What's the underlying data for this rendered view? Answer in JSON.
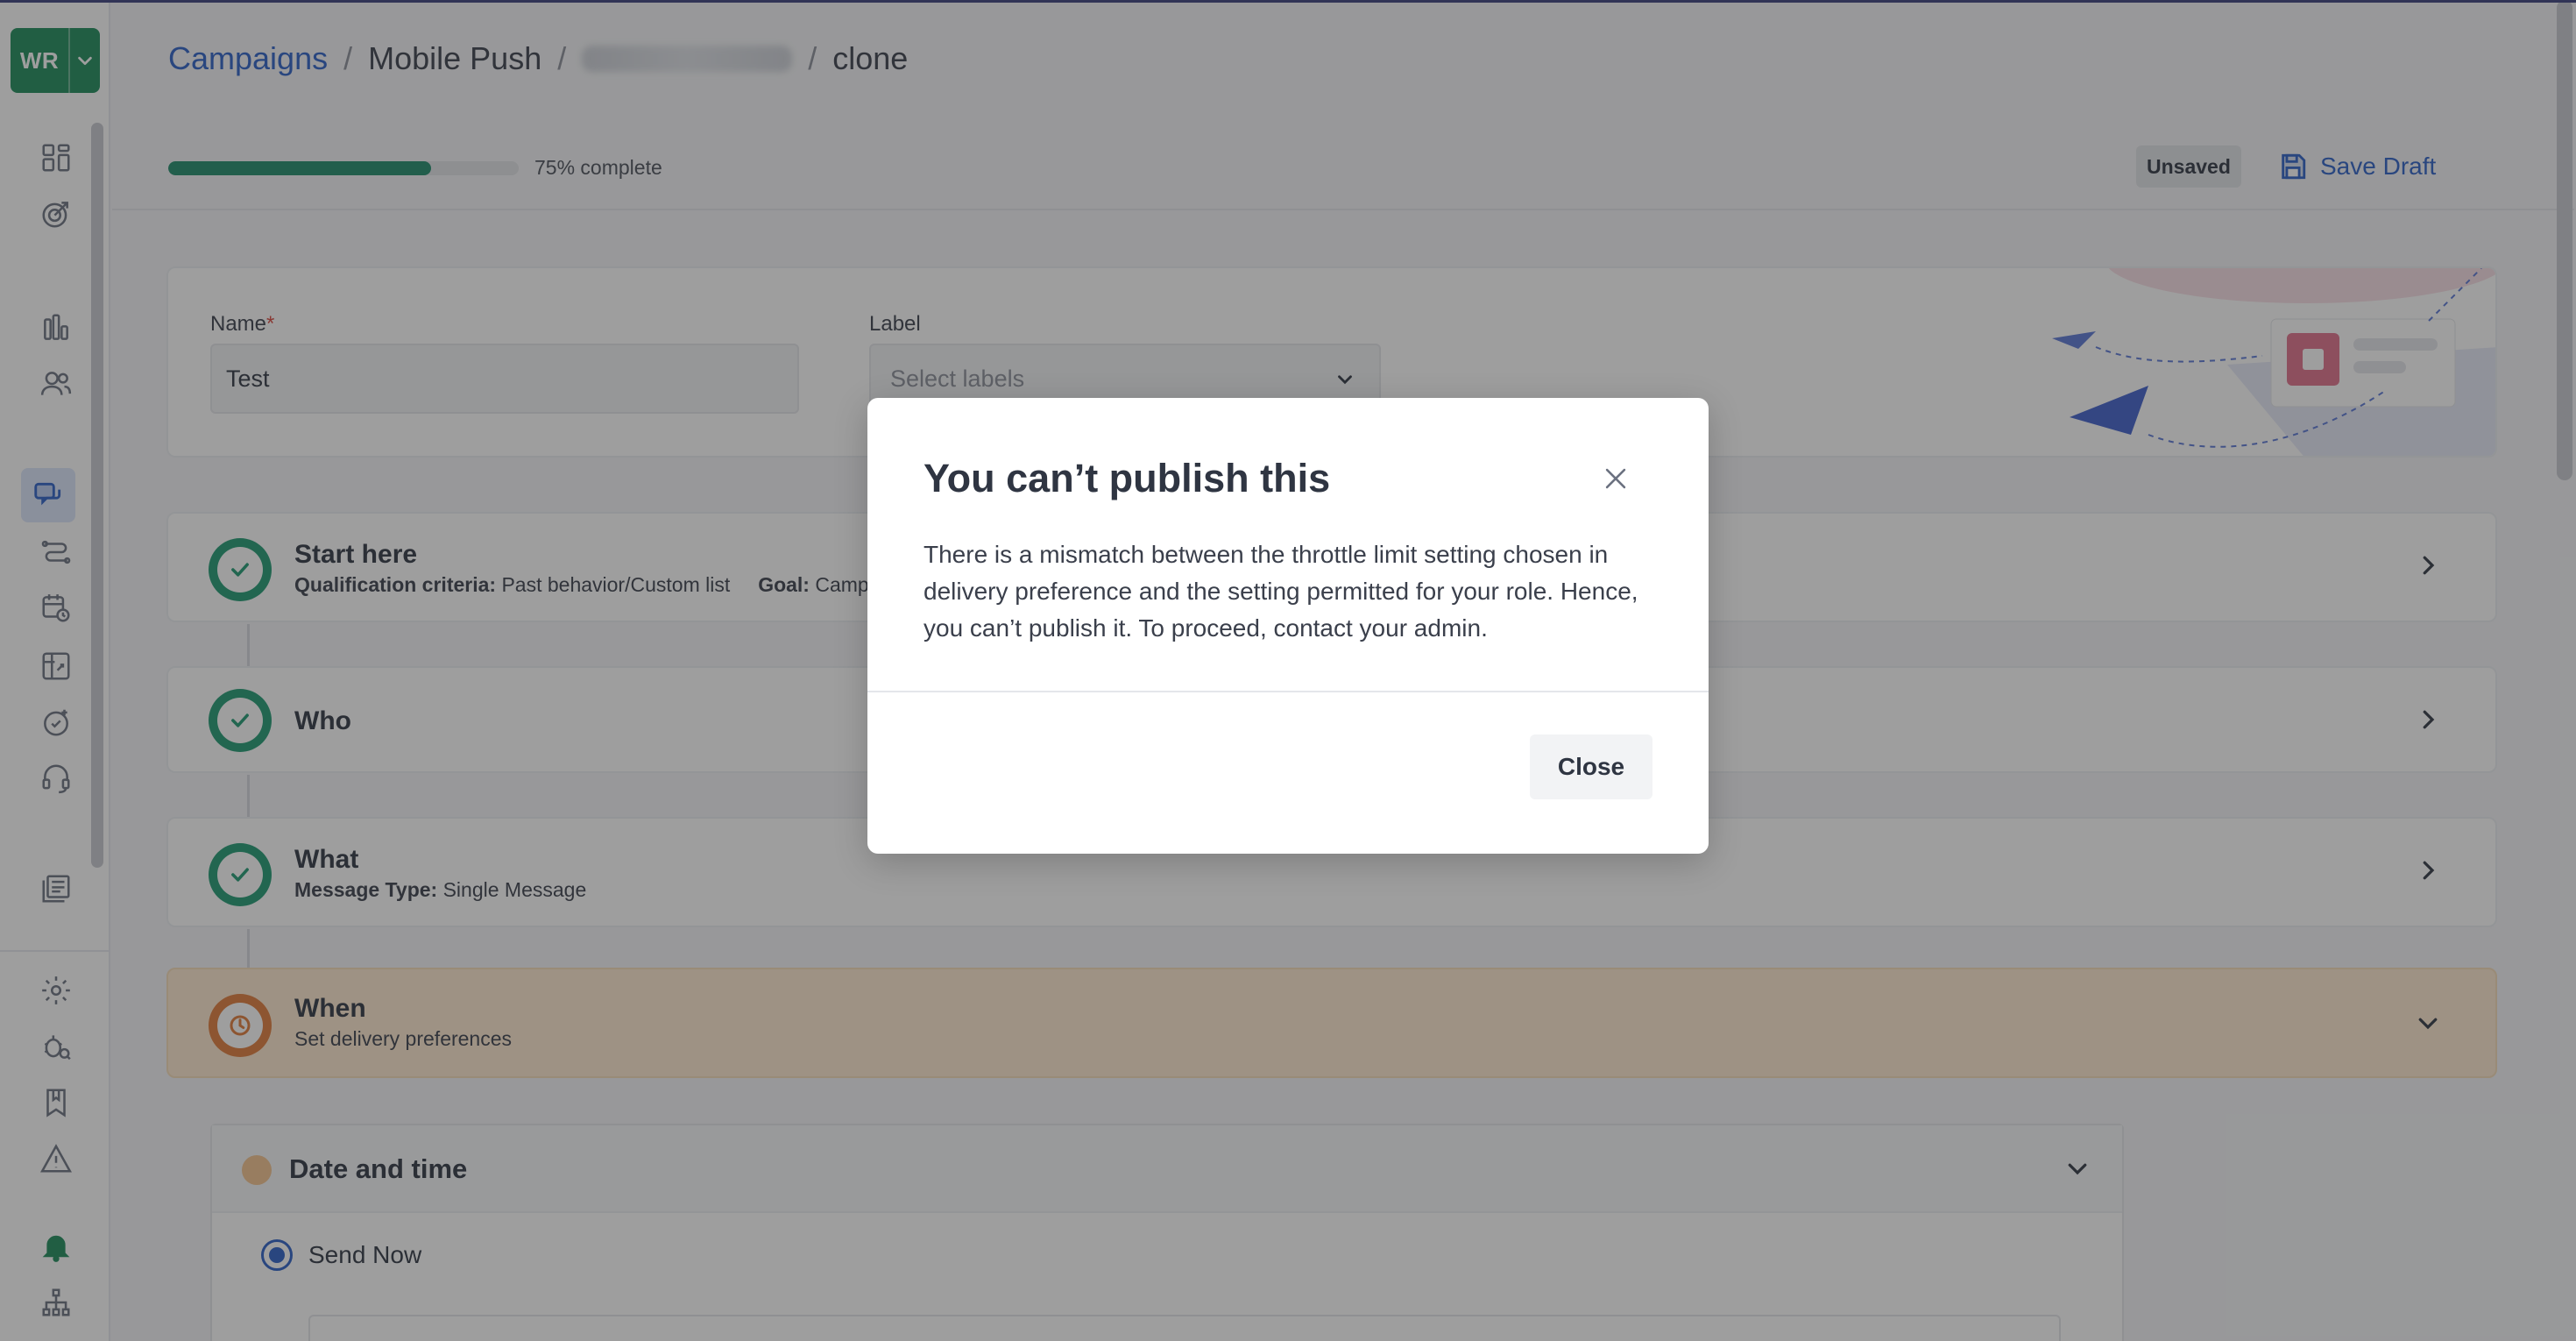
{
  "workspace": {
    "initials": "WR"
  },
  "breadcrumb": {
    "items": [
      "Campaigns",
      "Mobile Push",
      "clone"
    ],
    "separator": "/"
  },
  "progress": {
    "percent": 75,
    "label": "75% complete"
  },
  "header": {
    "status_badge": "Unsaved",
    "save_label": "Save Draft"
  },
  "name_card": {
    "name_label": "Name",
    "required_mark": "*",
    "name_value": "Test",
    "label_label": "Label",
    "label_placeholder": "Select labels"
  },
  "steps": [
    {
      "title": "Start here",
      "details": [
        {
          "key": "Qualification criteria:",
          "value": "Past behavior/Custom list"
        },
        {
          "key": "Goal:",
          "value": "Campa"
        }
      ]
    },
    {
      "title": "Who"
    },
    {
      "title": "What",
      "details": [
        {
          "key": "Message Type:",
          "value": "Single Message"
        }
      ]
    },
    {
      "title": "When",
      "subtitle": "Set delivery preferences"
    }
  ],
  "date_time": {
    "title": "Date and time",
    "option_selected": "Send Now"
  },
  "modal": {
    "title": "You can’t publish this",
    "body": "There is a mismatch between the throttle limit setting chosen in delivery preference and the setting permitted for your role. Hence, you can’t publish it. To proceed, contact your admin.",
    "close_button": "Close"
  },
  "colors": {
    "brand_green": "#1c8a5a",
    "link_blue": "#2b5fc7",
    "progress_green": "#1e8a6a",
    "when_highlight": "#ffe9cf",
    "overlay": "rgba(40,40,40,0.45)"
  }
}
